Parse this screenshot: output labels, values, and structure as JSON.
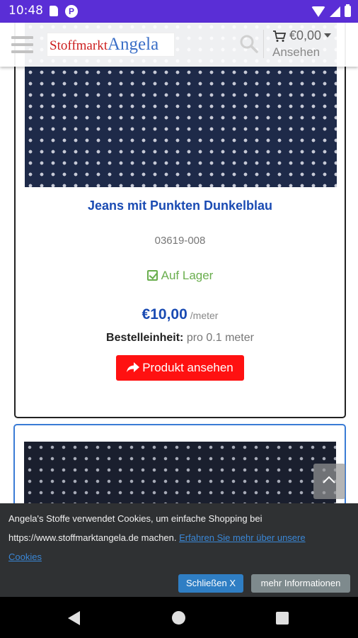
{
  "status_bar": {
    "time": "10:48",
    "p_badge": "P"
  },
  "header": {
    "logo_part1": "Stoffmarkt",
    "logo_part2": "Angela",
    "cart_amount": "€0,00",
    "cart_view_label": "Ansehen"
  },
  "product": {
    "title": "Jeans mit Punkten Dunkelblau",
    "sku": "03619-008",
    "stock": "Auf Lager",
    "price": "€10,00",
    "price_unit": "/meter",
    "order_unit_label": "Bestelleinheit:",
    "order_unit_value": " pro 0.1 meter",
    "view_button": "Produkt ansehen"
  },
  "cookie": {
    "text": "Angela's Stoffe verwendet Cookies, um einfache Shopping bei https://www.stoffmarktangela.de machen. ",
    "link": "Erfahren Sie mehr über unsere Cookies",
    "close_button": "Schließen X",
    "more_button": "mehr Informationen"
  },
  "colors": {
    "status_bar": "#5a2ed6",
    "price": "#1a4bb3",
    "button": "#ff1111",
    "cookie_bg": "#2f3133"
  }
}
